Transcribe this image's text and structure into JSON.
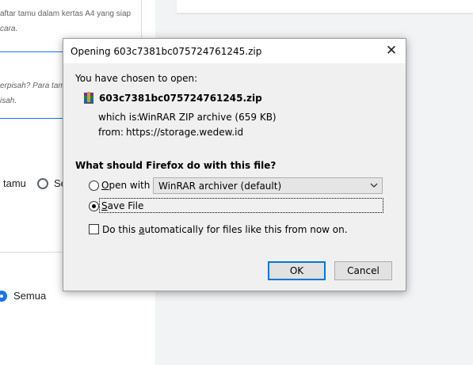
{
  "background": {
    "text_line1": "aftar tamu dalam kertas A4 yang siap",
    "text_line2": "cara.",
    "text_line3": "erpisah? Para tamu",
    "text_line4": "isah.",
    "radio1_label": "tamu",
    "radio2_label": "Se",
    "radio3_label": "Semua"
  },
  "dialog": {
    "title": "Opening 603c7381bc075724761245.zip",
    "close_icon": "close-icon",
    "chosen_text": "You have chosen to open:",
    "filename": "603c7381bc075724761245.zip",
    "which_is_label": "which is:",
    "which_is_value": "WinRAR ZIP archive (659 KB)",
    "from_label": "from:",
    "from_value": "https://storage.wedew.id",
    "question": "What should Firefox do with this file?",
    "open_with_label_pre": "",
    "open_with_accel": "O",
    "open_with_label_post": "pen with",
    "open_with_app": "WinRAR archiver (default)",
    "save_file_accel": "S",
    "save_file_label_post": "ave File",
    "auto_label_pre": "Do this ",
    "auto_accel": "a",
    "auto_label_post": "utomatically for files like this from now on.",
    "ok_label": "OK",
    "cancel_label": "Cancel",
    "selected_option": "save_file",
    "auto_checked": false
  }
}
